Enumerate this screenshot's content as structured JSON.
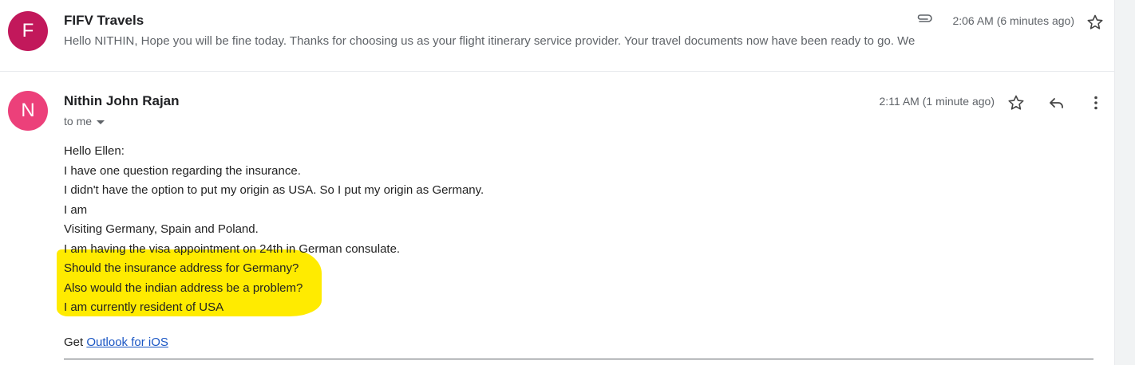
{
  "messages": [
    {
      "avatar_letter": "F",
      "sender": "FIFV Travels",
      "snippet": "Hello NITHIN, Hope you will be fine today. Thanks for choosing us as your flight itinerary service provider. Your travel documents now have been ready to go. We",
      "time": "2:06 AM (6 minutes ago)",
      "has_attachment": true
    },
    {
      "avatar_letter": "N",
      "sender": "Nithin John Rajan",
      "recipient_label": "to me",
      "time": "2:11 AM (1 minute ago)",
      "body_lines": [
        "Hello Ellen:",
        "I have one question regarding the insurance.",
        "I didn't have the option to put my origin as USA. So I put my origin as Germany.",
        "I am",
        "Visiting Germany, Spain and Poland.",
        "I am having the visa appointment on 24th in German consulate.",
        "Should the insurance address for Germany?",
        "Also would the indian address be a problem?",
        "I am currently resident of USA"
      ],
      "signature_prefix": "Get",
      "signature_link": "Outlook for iOS"
    }
  ],
  "colors": {
    "avatar_f": "#c2185b",
    "avatar_n": "#ec407a",
    "highlight": "#ffeb00",
    "link": "#1a56c4"
  }
}
